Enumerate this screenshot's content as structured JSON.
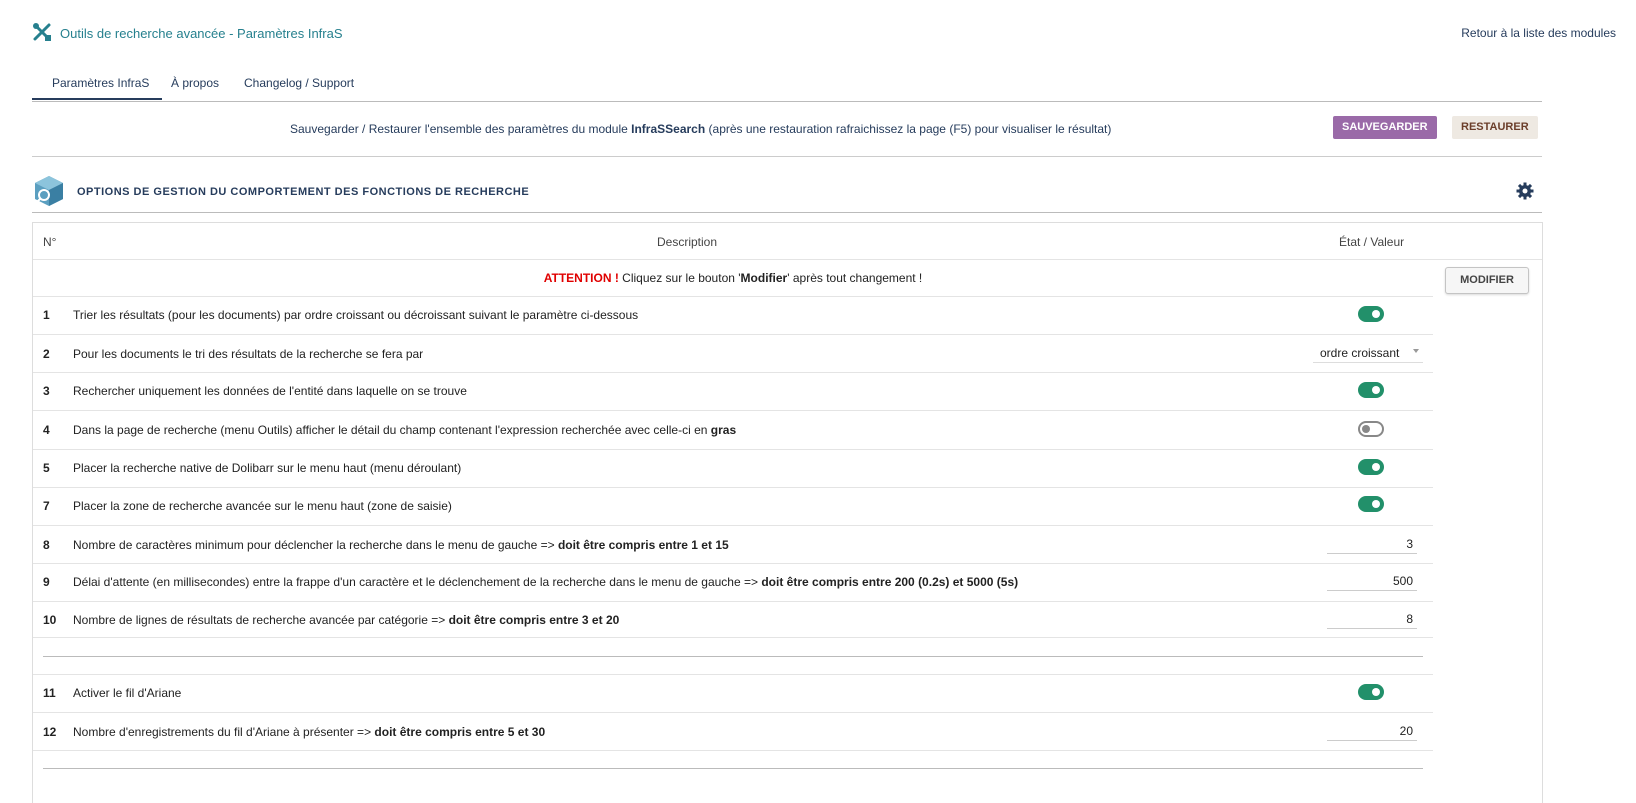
{
  "header": {
    "title": "Outils de recherche avancée - Paramètres InfraS",
    "back_link": "Retour à la liste des modules"
  },
  "tabs": [
    {
      "label": "Paramètres InfraS",
      "active": true
    },
    {
      "label": "À propos",
      "active": false
    },
    {
      "label": "Changelog / Support",
      "active": false
    }
  ],
  "backup_bar": {
    "text_before": "Sauvegarder / Restaurer l'ensemble des paramètres du module ",
    "module_name": "InfraSSearch",
    "text_after": " (après une restauration rafraichissez la page (F5) pour visualiser le résultat)",
    "save_label": "SAUVEGARDER",
    "restore_label": "RESTAURER"
  },
  "section": {
    "title": "OPTIONS DE GESTION DU COMPORTEMENT DES FONCTIONS DE RECHERCHE"
  },
  "table": {
    "col_num": "N°",
    "col_desc": "Description",
    "col_state": "État / Valeur",
    "warning_label": "ATTENTION !",
    "warning_text_1": " Cliquez sur le bouton '",
    "warning_bold": "Modifier",
    "warning_text_2": "' après tout changement !",
    "modify_label": "MODIFIER",
    "rows": [
      {
        "num": "1",
        "text": "Trier les résultats (pour les documents) par ordre croissant ou décroissant suivant le paramètre ci-dessous",
        "bold": "",
        "type": "toggle",
        "value": true
      },
      {
        "num": "2",
        "text": "Pour les documents le tri des résultats de la recherche se fera par",
        "bold": "",
        "type": "select",
        "value": "ordre croissant"
      },
      {
        "num": "3",
        "text": "Rechercher uniquement les données de l'entité dans laquelle on se trouve",
        "bold": "",
        "type": "toggle",
        "value": true
      },
      {
        "num": "4",
        "text": "Dans la page de recherche (menu Outils) afficher le détail du champ contenant l'expression recherchée avec celle-ci en ",
        "bold": "gras",
        "type": "toggle",
        "value": false
      },
      {
        "num": "5",
        "text": "Placer la recherche native de Dolibarr sur le menu haut (menu déroulant)",
        "bold": "",
        "type": "toggle",
        "value": true
      },
      {
        "num": "7",
        "text": "Placer la zone de recherche avancée sur le menu haut (zone de saisie)",
        "bold": "",
        "type": "toggle",
        "value": true
      },
      {
        "num": "8",
        "text": "Nombre de caractères minimum pour déclencher la recherche dans le menu de gauche => ",
        "bold": "doit être compris entre 1 et 15",
        "type": "number",
        "value": "3"
      },
      {
        "num": "9",
        "text": "Délai d'attente (en millisecondes) entre la frappe d'un caractère et le déclenchement de la recherche dans le menu de gauche => ",
        "bold": "doit être compris entre 200 (0.2s) et 5000 (5s)",
        "type": "number",
        "value": "500"
      },
      {
        "num": "10",
        "text": "Nombre de lignes de résultats de recherche avancée par catégorie => ",
        "bold": "doit être compris entre 3 et 20",
        "type": "number",
        "value": "8"
      },
      {
        "num": "11",
        "text": "Activer le fil d'Ariane",
        "bold": "",
        "type": "toggle",
        "value": true
      },
      {
        "num": "12",
        "text": "Nombre d'enregistrements du fil d'Ariane à présenter => ",
        "bold": "doit être compris entre 5 et 30",
        "type": "number",
        "value": "20"
      }
    ]
  },
  "colors": {
    "accent_teal": "#26808e",
    "nav_blue": "#263c5c",
    "save_purple": "#9a6aa8",
    "toggle_on": "#22906a",
    "warning_red": "#e00000"
  }
}
